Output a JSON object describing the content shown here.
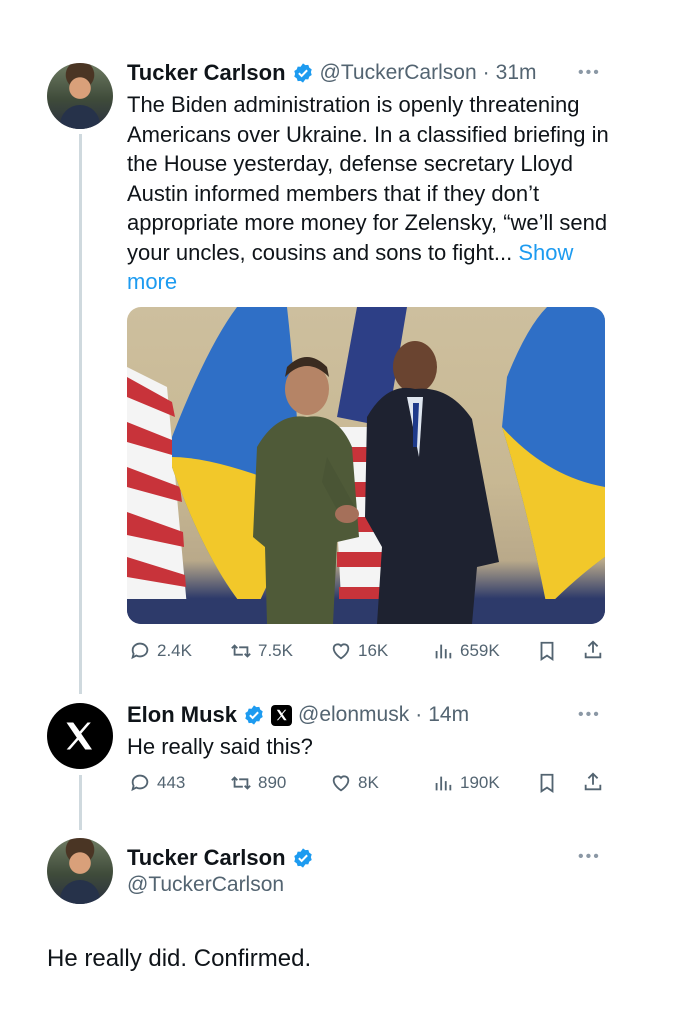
{
  "tweet1": {
    "name": "Tucker Carlson",
    "handle": "@TuckerCarlson",
    "sep": "·",
    "time": "31m",
    "text": "The Biden administration is openly threatening Americans over Ukraine. In a classified briefing in the House yesterday, defense secretary Lloyd Austin informed members that if they don’t appropriate more money for Zelensky, “we’ll send your uncles, cousins and sons to fight...",
    "show_more": "Show more",
    "replies": "2.4K",
    "reposts": "7.5K",
    "likes": "16K",
    "views": "659K"
  },
  "tweet2": {
    "name": "Elon Musk",
    "handle": "@elonmusk",
    "sep": "·",
    "time": "14m",
    "text": "He really said this?",
    "replies": "443",
    "reposts": "890",
    "likes": "8K",
    "views": "190K"
  },
  "tweet3": {
    "name": "Tucker Carlson",
    "handle": "@TuckerCarlson",
    "text": "He really did. Confirmed."
  },
  "colors": {
    "verified": "#1d9bf0",
    "link": "#1d9bf0",
    "secondary": "#536471",
    "thread_line": "#cfd9de"
  }
}
